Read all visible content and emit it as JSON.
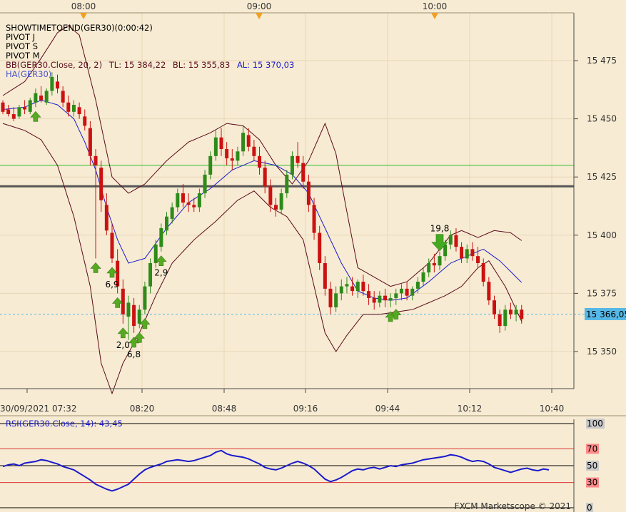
{
  "app": {
    "watermark": "FXCM Marketscope © 2021",
    "top_time_markers": [
      "08:00",
      "09:00",
      "10:00"
    ],
    "colors": {
      "background": "#f7ebd3",
      "grid": "#e8d7b7",
      "bull_candle": "#2e8b1a",
      "bear_candle": "#cc1111",
      "bb_band": "#5a0a1a",
      "bb_mid": "#1a1acc",
      "pivot_line": "#555555",
      "green_level": "#33bb33",
      "last_price": "#56b8e6",
      "rsi_line": "#1a1acc",
      "rsi_level": "#dd3333",
      "signal_arrow": "#55aa22",
      "marker_triangle": "#f0a020"
    }
  },
  "legend": {
    "lines": [
      {
        "text": "SHOWTIMETOEND(GER30)(0:00:42)",
        "color": "#000000"
      },
      {
        "text": "PIVOT J",
        "color": "#000000"
      },
      {
        "text": "PIVOT S",
        "color": "#000000"
      },
      {
        "text": "PIVOT M",
        "color": "#000000"
      }
    ],
    "bb": {
      "name": "BB(GER30.Close, 20, 2)",
      "tl": "TL: 15 384,22",
      "bl": "BL: 15 355,83",
      "al": "AL: 15 370,03"
    },
    "ha": "HA(GER30)"
  },
  "last_price_label": "15 366,05",
  "chart_data": [
    {
      "type": "candlestick",
      "title": "GER30",
      "ylim": [
        15330,
        15490
      ],
      "y_ticks": [
        "15 475",
        "15 450",
        "15 425",
        "15 400",
        "15 375",
        "15 350"
      ],
      "x_ticks": [
        "30/09/2021 07:32",
        "08:20",
        "08:48",
        "09:16",
        "09:44",
        "10:12",
        "10:40"
      ],
      "horizontal_levels": [
        {
          "name": "pivot-level",
          "value": 15421
        },
        {
          "name": "green-level",
          "value": 15430
        },
        {
          "name": "last-price",
          "value": 15366.05
        }
      ],
      "ohlc": [
        [
          15457,
          15458,
          15452,
          15453
        ],
        [
          15454,
          15456,
          15451,
          15452
        ],
        [
          15452,
          15455,
          15449,
          15450
        ],
        [
          15451,
          15456,
          15450,
          15455
        ],
        [
          15455,
          15458,
          15452,
          15454
        ],
        [
          15453,
          15459,
          15452,
          15458
        ],
        [
          15457,
          15463,
          15455,
          15461
        ],
        [
          15460,
          15464,
          15457,
          15458
        ],
        [
          15457,
          15463,
          15456,
          15462
        ],
        [
          15462,
          15470,
          15460,
          15468
        ],
        [
          15466,
          15469,
          15461,
          15463
        ],
        [
          15462,
          15464,
          15455,
          15457
        ],
        [
          15457,
          15460,
          15451,
          15453
        ],
        [
          15453,
          15458,
          15451,
          15456
        ],
        [
          15455,
          15457,
          15450,
          15452
        ],
        [
          15451,
          15454,
          15445,
          15447
        ],
        [
          15446,
          15449,
          15430,
          15434
        ],
        [
          15434,
          15437,
          15390,
          15430
        ],
        [
          15429,
          15432,
          15410,
          15415
        ],
        [
          15413,
          15418,
          15400,
          15402
        ],
        [
          15401,
          15405,
          15388,
          15390
        ],
        [
          15389,
          15394,
          15375,
          15378
        ],
        [
          15377,
          15381,
          15362,
          15366
        ],
        [
          15365,
          15374,
          15355,
          15371
        ],
        [
          15370,
          15373,
          15358,
          15361
        ],
        [
          15362,
          15370,
          15360,
          15368
        ],
        [
          15368,
          15380,
          15366,
          15378
        ],
        [
          15378,
          15390,
          15375,
          15388
        ],
        [
          15388,
          15398,
          15386,
          15396
        ],
        [
          15395,
          15405,
          15393,
          15403
        ],
        [
          15402,
          15410,
          15400,
          15408
        ],
        [
          15407,
          15414,
          15405,
          15412
        ],
        [
          15412,
          15420,
          15410,
          15418
        ],
        [
          15418,
          15422,
          15412,
          15414
        ],
        [
          15414,
          15418,
          15410,
          15413
        ],
        [
          15413,
          15416,
          15410,
          15412
        ],
        [
          15412,
          15420,
          15410,
          15418
        ],
        [
          15418,
          15428,
          15416,
          15426
        ],
        [
          15426,
          15436,
          15424,
          15434
        ],
        [
          15434,
          15445,
          15432,
          15442
        ],
        [
          15442,
          15446,
          15434,
          15437
        ],
        [
          15437,
          15440,
          15430,
          15433
        ],
        [
          15433,
          15437,
          15428,
          15432
        ],
        [
          15432,
          15438,
          15430,
          15436
        ],
        [
          15436,
          15447,
          15434,
          15444
        ],
        [
          15443,
          15446,
          15436,
          15438
        ],
        [
          15438,
          15441,
          15432,
          15434
        ],
        [
          15434,
          15438,
          15426,
          15429
        ],
        [
          15429,
          15432,
          15418,
          15421
        ],
        [
          15421,
          15424,
          15410,
          15413
        ],
        [
          15413,
          15416,
          15408,
          15411
        ],
        [
          15411,
          15420,
          15409,
          15418
        ],
        [
          15418,
          15428,
          15416,
          15426
        ],
        [
          15426,
          15436,
          15424,
          15434
        ],
        [
          15434,
          15440,
          15429,
          15431
        ],
        [
          15431,
          15434,
          15420,
          15423
        ],
        [
          15423,
          15426,
          15410,
          15413
        ],
        [
          15413,
          15416,
          15398,
          15401
        ],
        [
          15401,
          15404,
          15385,
          15388
        ],
        [
          15388,
          15391,
          15374,
          15377
        ],
        [
          15377,
          15380,
          15366,
          15369
        ],
        [
          15369,
          15378,
          15367,
          15375
        ],
        [
          15375,
          15381,
          15372,
          15378
        ],
        [
          15378,
          15382,
          15375,
          15379
        ],
        [
          15378,
          15382,
          15374,
          15376
        ],
        [
          15376,
          15381,
          15373,
          15380
        ],
        [
          15380,
          15383,
          15374,
          15376
        ],
        [
          15376,
          15379,
          15370,
          15373
        ],
        [
          15373,
          15376,
          15368,
          15371
        ],
        [
          15371,
          15376,
          15369,
          15374
        ],
        [
          15374,
          15377,
          15369,
          15372
        ],
        [
          15372,
          15375,
          15369,
          15373
        ],
        [
          15373,
          15377,
          15370,
          15375
        ],
        [
          15375,
          15379,
          15372,
          15377
        ],
        [
          15377,
          15380,
          15372,
          15374
        ],
        [
          15374,
          15378,
          15372,
          15377
        ],
        [
          15377,
          15382,
          15375,
          15380
        ],
        [
          15380,
          15386,
          15378,
          15384
        ],
        [
          15384,
          15390,
          15382,
          15388
        ],
        [
          15388,
          15392,
          15384,
          15387
        ],
        [
          15387,
          15393,
          15385,
          15391
        ],
        [
          15391,
          15398,
          15389,
          15396
        ],
        [
          15396,
          15402,
          15394,
          15400
        ],
        [
          15400,
          15403,
          15393,
          15395
        ],
        [
          15395,
          15397,
          15388,
          15390
        ],
        [
          15390,
          15396,
          15388,
          15394
        ],
        [
          15394,
          15397,
          15389,
          15391
        ],
        [
          15391,
          15395,
          15386,
          15388
        ],
        [
          15388,
          15390,
          15378,
          15380
        ],
        [
          15380,
          15382,
          15370,
          15372
        ],
        [
          15372,
          15374,
          15364,
          15366
        ],
        [
          15366,
          15368,
          15358,
          15361
        ],
        [
          15361,
          15370,
          15359,
          15368
        ],
        [
          15368,
          15371,
          15364,
          15366
        ],
        [
          15366,
          15370,
          15363,
          15368
        ],
        [
          15368,
          15370,
          15362,
          15364
        ]
      ],
      "bb_upper_anchors": [
        [
          0,
          15460
        ],
        [
          4,
          15466
        ],
        [
          7,
          15476
        ],
        [
          10,
          15487
        ],
        [
          12,
          15490
        ],
        [
          14,
          15486
        ],
        [
          17,
          15458
        ],
        [
          20,
          15425
        ],
        [
          23,
          15418
        ],
        [
          26,
          15422
        ],
        [
          30,
          15432
        ],
        [
          34,
          15440
        ],
        [
          38,
          15444
        ],
        [
          41,
          15448
        ],
        [
          44,
          15447
        ],
        [
          47,
          15441
        ],
        [
          50,
          15430
        ],
        [
          53,
          15422
        ],
        [
          56,
          15432
        ],
        [
          59,
          15448
        ],
        [
          61,
          15435
        ],
        [
          63,
          15410
        ],
        [
          65,
          15386
        ],
        [
          68,
          15382
        ],
        [
          71,
          15378
        ],
        [
          74,
          15380
        ],
        [
          78,
          15388
        ],
        [
          82,
          15400
        ],
        [
          84,
          15402
        ],
        [
          87,
          15399
        ],
        [
          90,
          15402
        ],
        [
          93,
          15401
        ],
        [
          96,
          15396
        ],
        [
          99,
          15386
        ]
      ],
      "bb_mid_anchors": [
        [
          0,
          15454
        ],
        [
          4,
          15455
        ],
        [
          7,
          15458
        ],
        [
          10,
          15456
        ],
        [
          13,
          15450
        ],
        [
          15,
          15440
        ],
        [
          17,
          15428
        ],
        [
          19,
          15412
        ],
        [
          21,
          15398
        ],
        [
          23,
          15388
        ],
        [
          26,
          15390
        ],
        [
          30,
          15403
        ],
        [
          34,
          15414
        ],
        [
          38,
          15420
        ],
        [
          42,
          15428
        ],
        [
          46,
          15432
        ],
        [
          50,
          15430
        ],
        [
          53,
          15426
        ],
        [
          56,
          15418
        ],
        [
          59,
          15403
        ],
        [
          62,
          15388
        ],
        [
          65,
          15376
        ],
        [
          68,
          15373
        ],
        [
          71,
          15372
        ],
        [
          74,
          15373
        ],
        [
          78,
          15380
        ],
        [
          82,
          15388
        ],
        [
          85,
          15391
        ],
        [
          88,
          15394
        ],
        [
          91,
          15389
        ],
        [
          94,
          15382
        ],
        [
          97,
          15375
        ],
        [
          99,
          15370
        ]
      ],
      "bb_lower_anchors": [
        [
          0,
          15448
        ],
        [
          4,
          15445
        ],
        [
          7,
          15441
        ],
        [
          10,
          15430
        ],
        [
          13,
          15408
        ],
        [
          16,
          15378
        ],
        [
          18,
          15345
        ],
        [
          20,
          15332
        ],
        [
          22,
          15345
        ],
        [
          25,
          15358
        ],
        [
          28,
          15374
        ],
        [
          31,
          15388
        ],
        [
          35,
          15398
        ],
        [
          39,
          15406
        ],
        [
          43,
          15415
        ],
        [
          46,
          15419
        ],
        [
          49,
          15412
        ],
        [
          52,
          15408
        ],
        [
          55,
          15398
        ],
        [
          57,
          15378
        ],
        [
          59,
          15358
        ],
        [
          61,
          15350
        ],
        [
          63,
          15357
        ],
        [
          66,
          15366
        ],
        [
          69,
          15366
        ],
        [
          72,
          15367
        ],
        [
          75,
          15368
        ],
        [
          78,
          15371
        ],
        [
          81,
          15374
        ],
        [
          84,
          15378
        ],
        [
          87,
          15386
        ],
        [
          89,
          15389
        ],
        [
          92,
          15378
        ],
        [
          95,
          15363
        ],
        [
          97,
          15356
        ],
        [
          99,
          15357
        ]
      ],
      "signals": [
        {
          "index": 6,
          "type": "up",
          "label": ""
        },
        {
          "index": 17,
          "type": "up",
          "label": ""
        },
        {
          "index": 21,
          "type": "up",
          "label": ""
        },
        {
          "index": 20,
          "type": "up",
          "label": "6,9"
        },
        {
          "index": 22,
          "type": "up",
          "label": "2,0"
        },
        {
          "index": 24,
          "type": "up",
          "label": "6,8"
        },
        {
          "index": 25,
          "type": "up",
          "label": ""
        },
        {
          "index": 26,
          "type": "up",
          "label": ""
        },
        {
          "index": 29,
          "type": "up",
          "label": "2,9"
        },
        {
          "index": 71,
          "type": "up",
          "label": ""
        },
        {
          "index": 72,
          "type": "up",
          "label": ""
        },
        {
          "index": 80,
          "type": "down",
          "label": "19,8"
        }
      ]
    },
    {
      "type": "line",
      "title": "RSI(GER30.Close, 14): 43,45",
      "ylim": [
        0,
        100
      ],
      "y_ticks": [
        "100",
        "70",
        "50",
        "30",
        "0"
      ],
      "levels": [
        70,
        50,
        30
      ],
      "series": [
        {
          "name": "RSI(GER30.Close, 14)",
          "values": [
            49,
            51,
            52,
            50,
            53,
            54,
            55,
            57,
            56,
            54,
            52,
            49,
            47,
            45,
            41,
            37,
            33,
            28,
            25,
            22,
            20,
            22,
            25,
            28,
            34,
            40,
            45,
            48,
            50,
            52,
            55,
            56,
            57,
            56,
            55,
            56,
            58,
            60,
            62,
            66,
            68,
            64,
            62,
            61,
            60,
            58,
            55,
            52,
            48,
            46,
            45,
            47,
            50,
            53,
            55,
            53,
            50,
            46,
            40,
            34,
            31,
            33,
            36,
            40,
            44,
            46,
            45,
            47,
            48,
            46,
            48,
            50,
            49,
            51,
            52,
            53,
            55,
            57,
            58,
            59,
            60,
            61,
            63,
            62,
            60,
            57,
            55,
            56,
            55,
            52,
            48,
            46,
            44,
            42,
            44,
            46,
            47,
            45,
            44,
            46,
            45
          ]
        }
      ]
    }
  ]
}
